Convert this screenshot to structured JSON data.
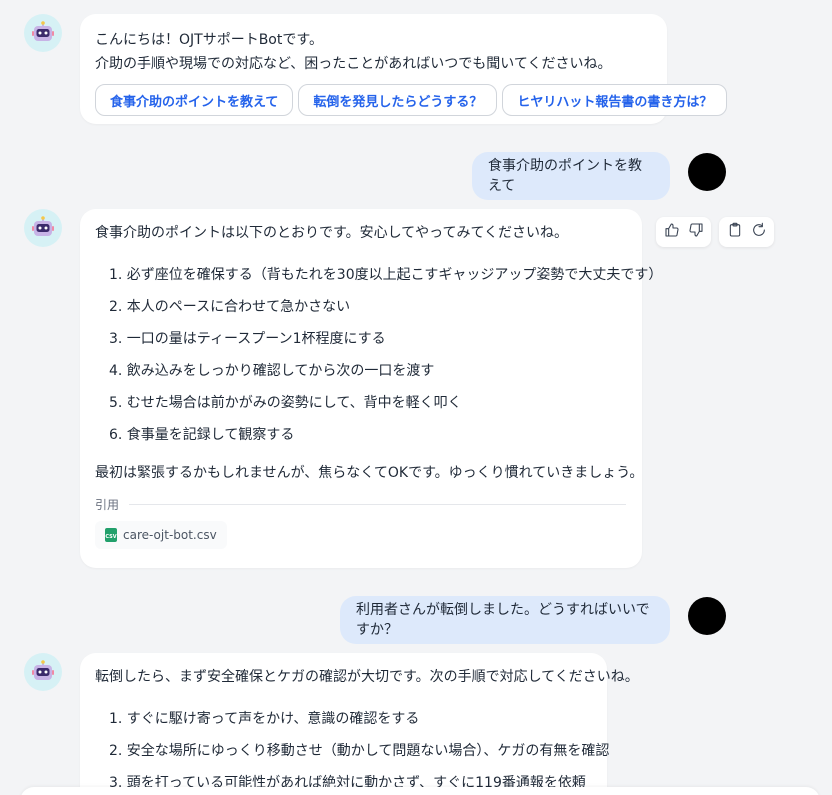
{
  "messages": {
    "greeting": {
      "line1": "こんにちは！OJTサポートBotです。",
      "line2": "介助の手順や現場での対応など、困ったことがあればいつでも聞いてくださいね。",
      "suggestions": [
        "食事介助のポイントを教えて",
        "転倒を発見したらどうする？",
        "ヒヤリハット報告書の書き方は？"
      ]
    },
    "user1": "食事介助のポイントを教えて",
    "bot1": {
      "intro": "食事介助のポイントは以下のとおりです。安心してやってみてくださいね。",
      "items": [
        "1. 必ず座位を確保する（背もたれを30度以上起こすギャッジアップ姿勢で大丈夫です）",
        "2. 本人のペースに合わせて急かさない",
        "3. 一口の量はティースプーン1杯程度にする",
        "4. 飲み込みをしっかり確認してから次の一口を渡す",
        "5. むせた場合は前かがみの姿勢にして、背中を軽く叩く",
        "6. 食事量を記録して観察する"
      ],
      "outro": "最初は緊張するかもしれませんが、焦らなくてOKです。ゆっくり慣れていきましょう。",
      "citation_label": "引用",
      "citation_file": "care-ojt-bot.csv",
      "csv_badge": "CSV"
    },
    "user2": "利用者さんが転倒しました。どうすればいいですか？",
    "bot2": {
      "intro": "転倒したら、まず安全確保とケガの確認が大切です。次の手順で対応してくださいね。",
      "items": [
        "1. すぐに駆け寄って声をかけ、意識の確認をする",
        "2. 安全な場所にゆっくり移動させ（動かして問題ない場合）、ケガの有無を確認",
        "3. 頭を打っている可能性があれば絶対に動かさず、すぐに119番通報を依頼"
      ]
    }
  },
  "icons": {
    "bot_avatar": "robot-icon",
    "thumbs_up": "thumbs-up-icon",
    "thumbs_down": "thumbs-down-icon",
    "copy": "clipboard-icon",
    "regenerate": "refresh-icon"
  },
  "colors": {
    "accent": "#2563eb",
    "user_bubble": "#dde9fb",
    "avatar_bg": "#d6f1f5",
    "csv": "#22a06b"
  }
}
